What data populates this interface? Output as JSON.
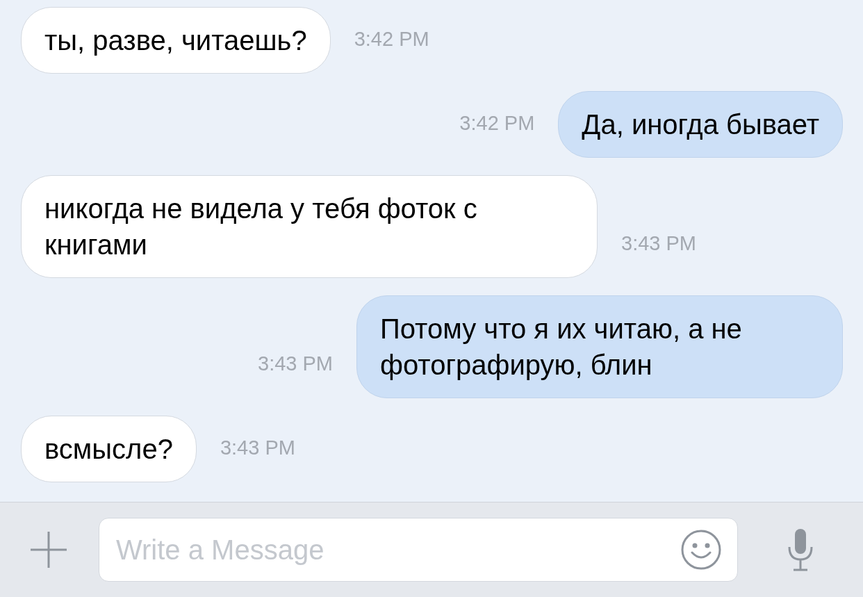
{
  "messages": [
    {
      "kind": "incoming",
      "text": "ты, разве, читаешь?",
      "time": "3:42 PM"
    },
    {
      "kind": "outgoing",
      "text": "Да, иногда бывает",
      "time": "3:42 PM"
    },
    {
      "kind": "incoming",
      "text": "никогда не видела у тебя фоток с книгами",
      "time": "3:43 PM"
    },
    {
      "kind": "outgoing",
      "text": "Потому что я их читаю, а не фотографирую, блин",
      "time": "3:43 PM"
    },
    {
      "kind": "incoming",
      "text": "всмысле?",
      "time": "3:43 PM"
    }
  ],
  "composer": {
    "placeholder": "Write a Message"
  }
}
